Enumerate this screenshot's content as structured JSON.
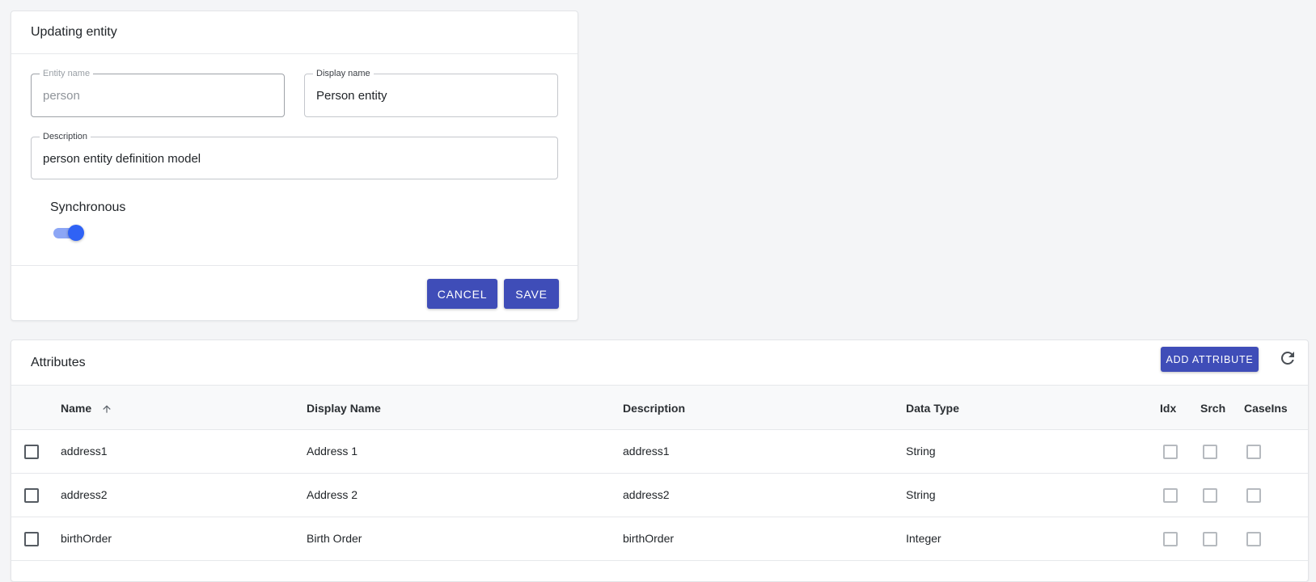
{
  "entity_form": {
    "title": "Updating entity",
    "entity_name": {
      "label": "Entity name",
      "value": "person",
      "disabled": true
    },
    "display_name": {
      "label": "Display name",
      "value": "Person entity"
    },
    "description": {
      "label": "Description",
      "value": "person entity definition model"
    },
    "synchronous": {
      "label": "Synchronous",
      "checked": true
    },
    "cancel_label": "CANCEL",
    "save_label": "SAVE"
  },
  "attributes": {
    "title": "Attributes",
    "add_label": "ADD ATTRIBUTE",
    "refresh_icon": "refresh-icon",
    "columns": {
      "name": "Name",
      "display_name": "Display Name",
      "description": "Description",
      "data_type": "Data Type",
      "idx": "Idx",
      "srch": "Srch",
      "caseins": "CaseIns"
    },
    "sort": {
      "column": "name",
      "direction": "ascending",
      "icon": "arrow-up-icon"
    },
    "rows": [
      {
        "name": "address1",
        "display_name": "Address 1",
        "description": "address1",
        "data_type": "String",
        "selected": false,
        "idx": false,
        "srch": false,
        "caseins": false
      },
      {
        "name": "address2",
        "display_name": "Address 2",
        "description": "address2",
        "data_type": "String",
        "selected": false,
        "idx": false,
        "srch": false,
        "caseins": false
      },
      {
        "name": "birthOrder",
        "display_name": "Birth Order",
        "description": "birthOrder",
        "data_type": "Integer",
        "selected": false,
        "idx": false,
        "srch": false,
        "caseins": false
      }
    ]
  },
  "colors": {
    "primary_button": "#3f4db8",
    "toggle_thumb": "#2f62f5",
    "toggle_track": "#8ca6f5",
    "page_background": "#f4f5f7"
  }
}
